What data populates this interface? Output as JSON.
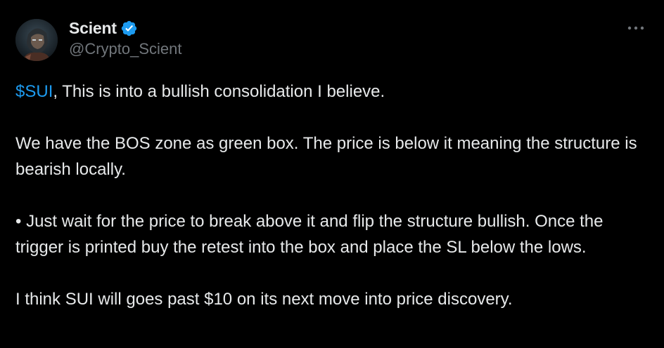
{
  "author": {
    "display_name": "Scient",
    "handle": "@Crypto_Scient",
    "verified": true
  },
  "tweet": {
    "cashtag": "$SUI",
    "line1_rest": ", This is into a bullish consolidation I believe.",
    "para2": "We have the BOS zone as green box. The price is below it meaning the structure is bearish locally.",
    "para3": "• Just wait for the price to break above it and flip the structure bullish. Once the trigger is printed buy the retest into the box and place the SL below the lows.",
    "para4": "I think SUI will goes past $10 on its next move into price discovery."
  },
  "icons": {
    "verified": "verified-badge-icon",
    "more": "more-options-icon"
  },
  "colors": {
    "background": "#000000",
    "text": "#e7e9ea",
    "secondary": "#71767b",
    "accent": "#1d9bf0"
  }
}
